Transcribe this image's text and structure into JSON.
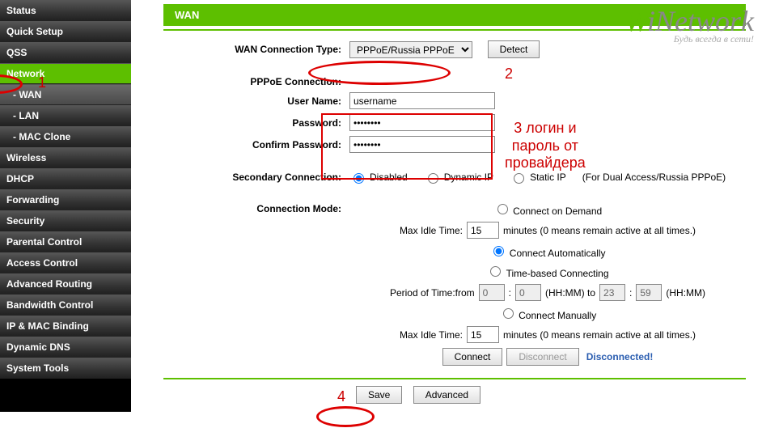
{
  "sidebar": {
    "items": [
      {
        "label": "Status"
      },
      {
        "label": "Quick Setup"
      },
      {
        "label": "QSS"
      },
      {
        "label": "Network"
      },
      {
        "label": "- WAN"
      },
      {
        "label": "- LAN"
      },
      {
        "label": "- MAC Clone"
      },
      {
        "label": "Wireless"
      },
      {
        "label": "DHCP"
      },
      {
        "label": "Forwarding"
      },
      {
        "label": "Security"
      },
      {
        "label": "Parental Control"
      },
      {
        "label": "Access Control"
      },
      {
        "label": "Advanced Routing"
      },
      {
        "label": "Bandwidth Control"
      },
      {
        "label": "IP & MAC Binding"
      },
      {
        "label": "Dynamic DNS"
      },
      {
        "label": "System Tools"
      }
    ]
  },
  "logo": {
    "text_w": "W",
    "text_i": "i",
    "text_rest": "Network",
    "tagline": "Будь всегда в сети!"
  },
  "page": {
    "title": "WAN"
  },
  "form": {
    "conn_type_label": "WAN Connection Type:",
    "conn_type_value": "PPPoE/Russia PPPoE",
    "detect_btn": "Detect",
    "pppoe_header": "PPPoE Connection:",
    "username_label": "User Name:",
    "username_value": "username",
    "password_label": "Password:",
    "password_value": "********",
    "confirm_label": "Confirm Password:",
    "confirm_value": "********",
    "secondary_label": "Secondary Connection:",
    "sec_disabled": "Disabled",
    "sec_dynamic": "Dynamic IP",
    "sec_static": "Static IP",
    "sec_note": "(For Dual Access/Russia PPPoE)",
    "mode_label": "Connection Mode:",
    "mode_demand": "Connect on Demand",
    "idle_label": "Max Idle Time:",
    "idle_value": "15",
    "idle_note": "minutes (0 means remain active at all times.)",
    "mode_auto": "Connect Automatically",
    "mode_time": "Time-based Connecting",
    "period_label": "Period of Time:from",
    "p_from_hh": "0",
    "p_from_mm": "0",
    "p_hhmm_a": "(HH:MM) to",
    "p_to_hh": "23",
    "p_to_mm": "59",
    "p_hhmm_b": "(HH:MM)",
    "mode_manual": "Connect Manually",
    "idle2_value": "15",
    "connect_btn": "Connect",
    "disconnect_btn": "Disconnect",
    "status_txt": "Disconnected!",
    "save_btn": "Save",
    "advanced_btn": "Advanced"
  },
  "ann": {
    "n1": "1",
    "n2": "2",
    "n4": "4",
    "n3": "3 логин и\nпароль от\nпровайдера"
  }
}
